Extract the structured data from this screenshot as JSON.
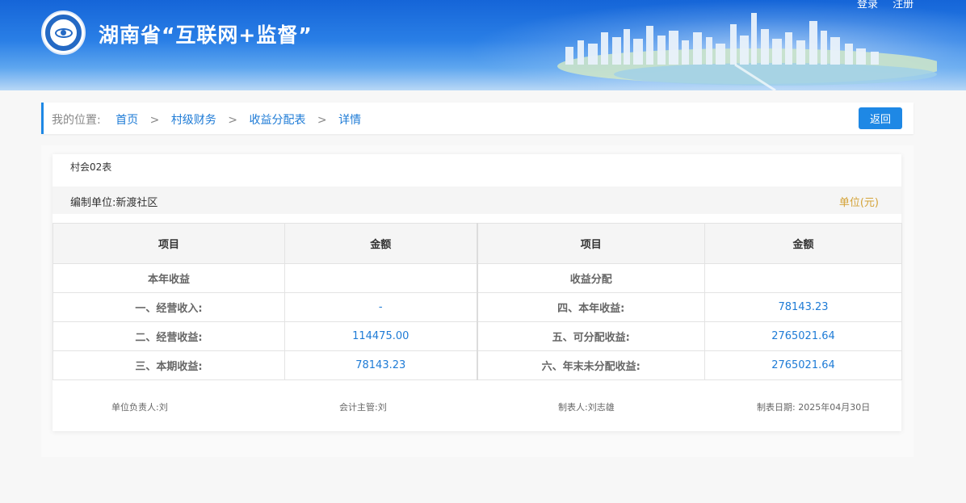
{
  "header": {
    "title": "湖南省“互联网+监督”",
    "links": [
      "登录",
      "注册"
    ]
  },
  "breadcrumb": {
    "label": "我的位置:",
    "items": [
      "首页",
      "村级财务",
      "收益分配表",
      "详情"
    ],
    "separator": ">"
  },
  "actions": {
    "back_label": "返回"
  },
  "report": {
    "form_code": "村会02表",
    "unit_name": "编制单位:新渡社区",
    "unit": "单位(元)",
    "headers": [
      "项目",
      "金额",
      "项目",
      "金额"
    ],
    "rows": [
      {
        "left_item": "本年收益",
        "left_amount": "",
        "right_item": "收益分配",
        "right_amount": ""
      },
      {
        "left_item": "一、经营收入:",
        "left_amount": "-",
        "right_item": "四、本年收益:",
        "right_amount": "78143.23"
      },
      {
        "left_item": "二、经营收益:",
        "left_amount": "114475.00",
        "right_item": "五、可分配收益:",
        "right_amount": "2765021.64"
      },
      {
        "left_item": "三、本期收益:",
        "left_amount": "78143.23",
        "right_item": "六、年末未分配收益:",
        "right_amount": "2765021.64"
      }
    ],
    "signatures": {
      "unit_head": "单位负责人:刘",
      "accounting_head": "会计主管:刘",
      "preparer": "制表人:刘志雄",
      "date": "制表日期: 2025年04月30日"
    }
  },
  "colors": {
    "accent": "#1e88e5",
    "amount": "#1e7bd6",
    "unit": "#d4a338"
  }
}
